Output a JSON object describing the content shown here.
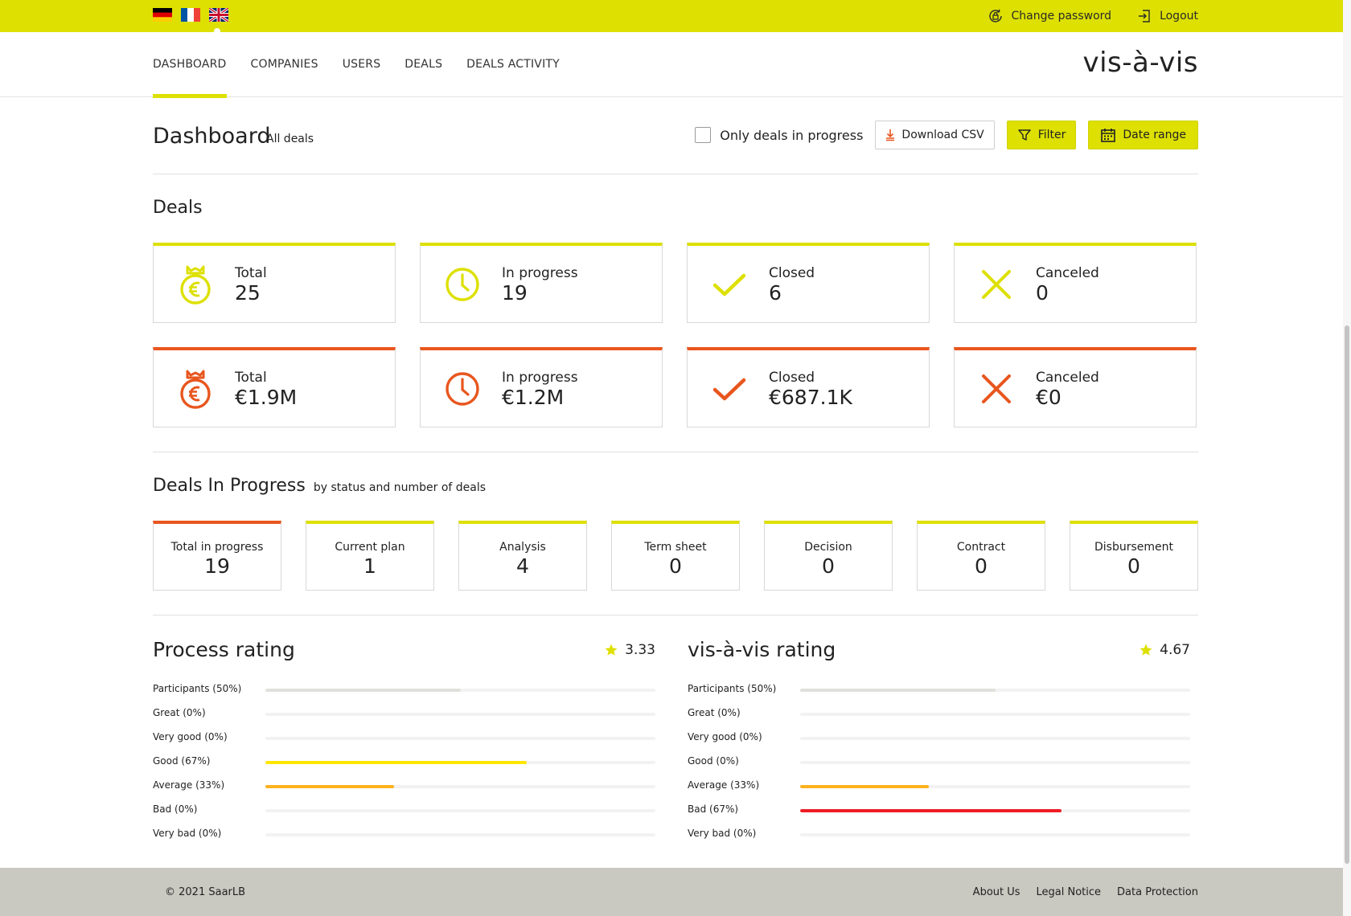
{
  "colors": {
    "accent": "#dde000",
    "accent_orange": "#e8561e",
    "good": "#ffe600",
    "average": "#fbb21d",
    "bad": "#ee1c25",
    "participants": "#e0e0dc"
  },
  "languages": [
    {
      "name": "German",
      "icon": "flag-de-icon"
    },
    {
      "name": "French",
      "icon": "flag-fr-icon"
    },
    {
      "name": "English",
      "icon": "flag-uk-icon",
      "active": true
    }
  ],
  "topbar": {
    "change_password": "Change password",
    "logout": "Logout"
  },
  "nav": {
    "items": [
      "DASHBOARD",
      "COMPANIES",
      "USERS",
      "DEALS",
      "DEALS ACTIVITY"
    ],
    "active": "DASHBOARD",
    "brand": "vis-à-vis"
  },
  "dashboard": {
    "title": "Dashboard",
    "subtitle": "All deals",
    "only_in_progress_label": "Only deals in progress",
    "only_in_progress_checked": false,
    "download_csv": "Download CSV",
    "filter": "Filter",
    "date_range": "Date range"
  },
  "deals": {
    "title": "Deals",
    "count_cards": [
      {
        "label": "Total",
        "value": "25",
        "icon": "money-bag-euro-icon"
      },
      {
        "label": "In progress",
        "value": "19",
        "icon": "clock-icon"
      },
      {
        "label": "Closed",
        "value": "6",
        "icon": "checkmark-icon"
      },
      {
        "label": "Canceled",
        "value": "0",
        "icon": "cross-icon"
      }
    ],
    "amount_cards": [
      {
        "label": "Total",
        "value": "€1.9M",
        "icon": "money-bag-euro-icon"
      },
      {
        "label": "In progress",
        "value": "€1.2M",
        "icon": "clock-icon"
      },
      {
        "label": "Closed",
        "value": "€687.1K",
        "icon": "checkmark-icon"
      },
      {
        "label": "Canceled",
        "value": "€0",
        "icon": "cross-icon"
      }
    ]
  },
  "in_progress": {
    "title": "Deals In Progress",
    "subtitle": "by status and number of deals",
    "cards": [
      {
        "label": "Total in progress",
        "value": "19"
      },
      {
        "label": "Current plan",
        "value": "1"
      },
      {
        "label": "Analysis",
        "value": "4"
      },
      {
        "label": "Term sheet",
        "value": "0"
      },
      {
        "label": "Decision",
        "value": "0"
      },
      {
        "label": "Contract",
        "value": "0"
      },
      {
        "label": "Disbursement",
        "value": "0"
      }
    ]
  },
  "process_rating": {
    "title": "Process rating",
    "score": "3.33",
    "rows": [
      {
        "label": "Participants (50%)",
        "percent": 50,
        "color": "#e0e0dc"
      },
      {
        "label": "Great (0%)",
        "percent": 0,
        "color": "#ffe600"
      },
      {
        "label": "Very good (0%)",
        "percent": 0,
        "color": "#ffe600"
      },
      {
        "label": "Good (67%)",
        "percent": 67,
        "color": "#ffe600"
      },
      {
        "label": "Average (33%)",
        "percent": 33,
        "color": "#fbb21d"
      },
      {
        "label": "Bad (0%)",
        "percent": 0,
        "color": "#ee1c25"
      },
      {
        "label": "Very bad (0%)",
        "percent": 0,
        "color": "#ee1c25"
      }
    ]
  },
  "visavis_rating": {
    "title": "vis-à-vis rating",
    "score": "4.67",
    "rows": [
      {
        "label": "Participants (50%)",
        "percent": 50,
        "color": "#e0e0dc"
      },
      {
        "label": "Great (0%)",
        "percent": 0,
        "color": "#ffe600"
      },
      {
        "label": "Very good (0%)",
        "percent": 0,
        "color": "#ffe600"
      },
      {
        "label": "Good (0%)",
        "percent": 0,
        "color": "#ffe600"
      },
      {
        "label": "Average (33%)",
        "percent": 33,
        "color": "#fbb21d"
      },
      {
        "label": "Bad (67%)",
        "percent": 67,
        "color": "#ee1c25"
      },
      {
        "label": "Very bad (0%)",
        "percent": 0,
        "color": "#ee1c25"
      }
    ]
  },
  "footer": {
    "copyright": "© 2021 SaarLB",
    "links": [
      "About Us",
      "Legal Notice",
      "Data Protection"
    ]
  }
}
